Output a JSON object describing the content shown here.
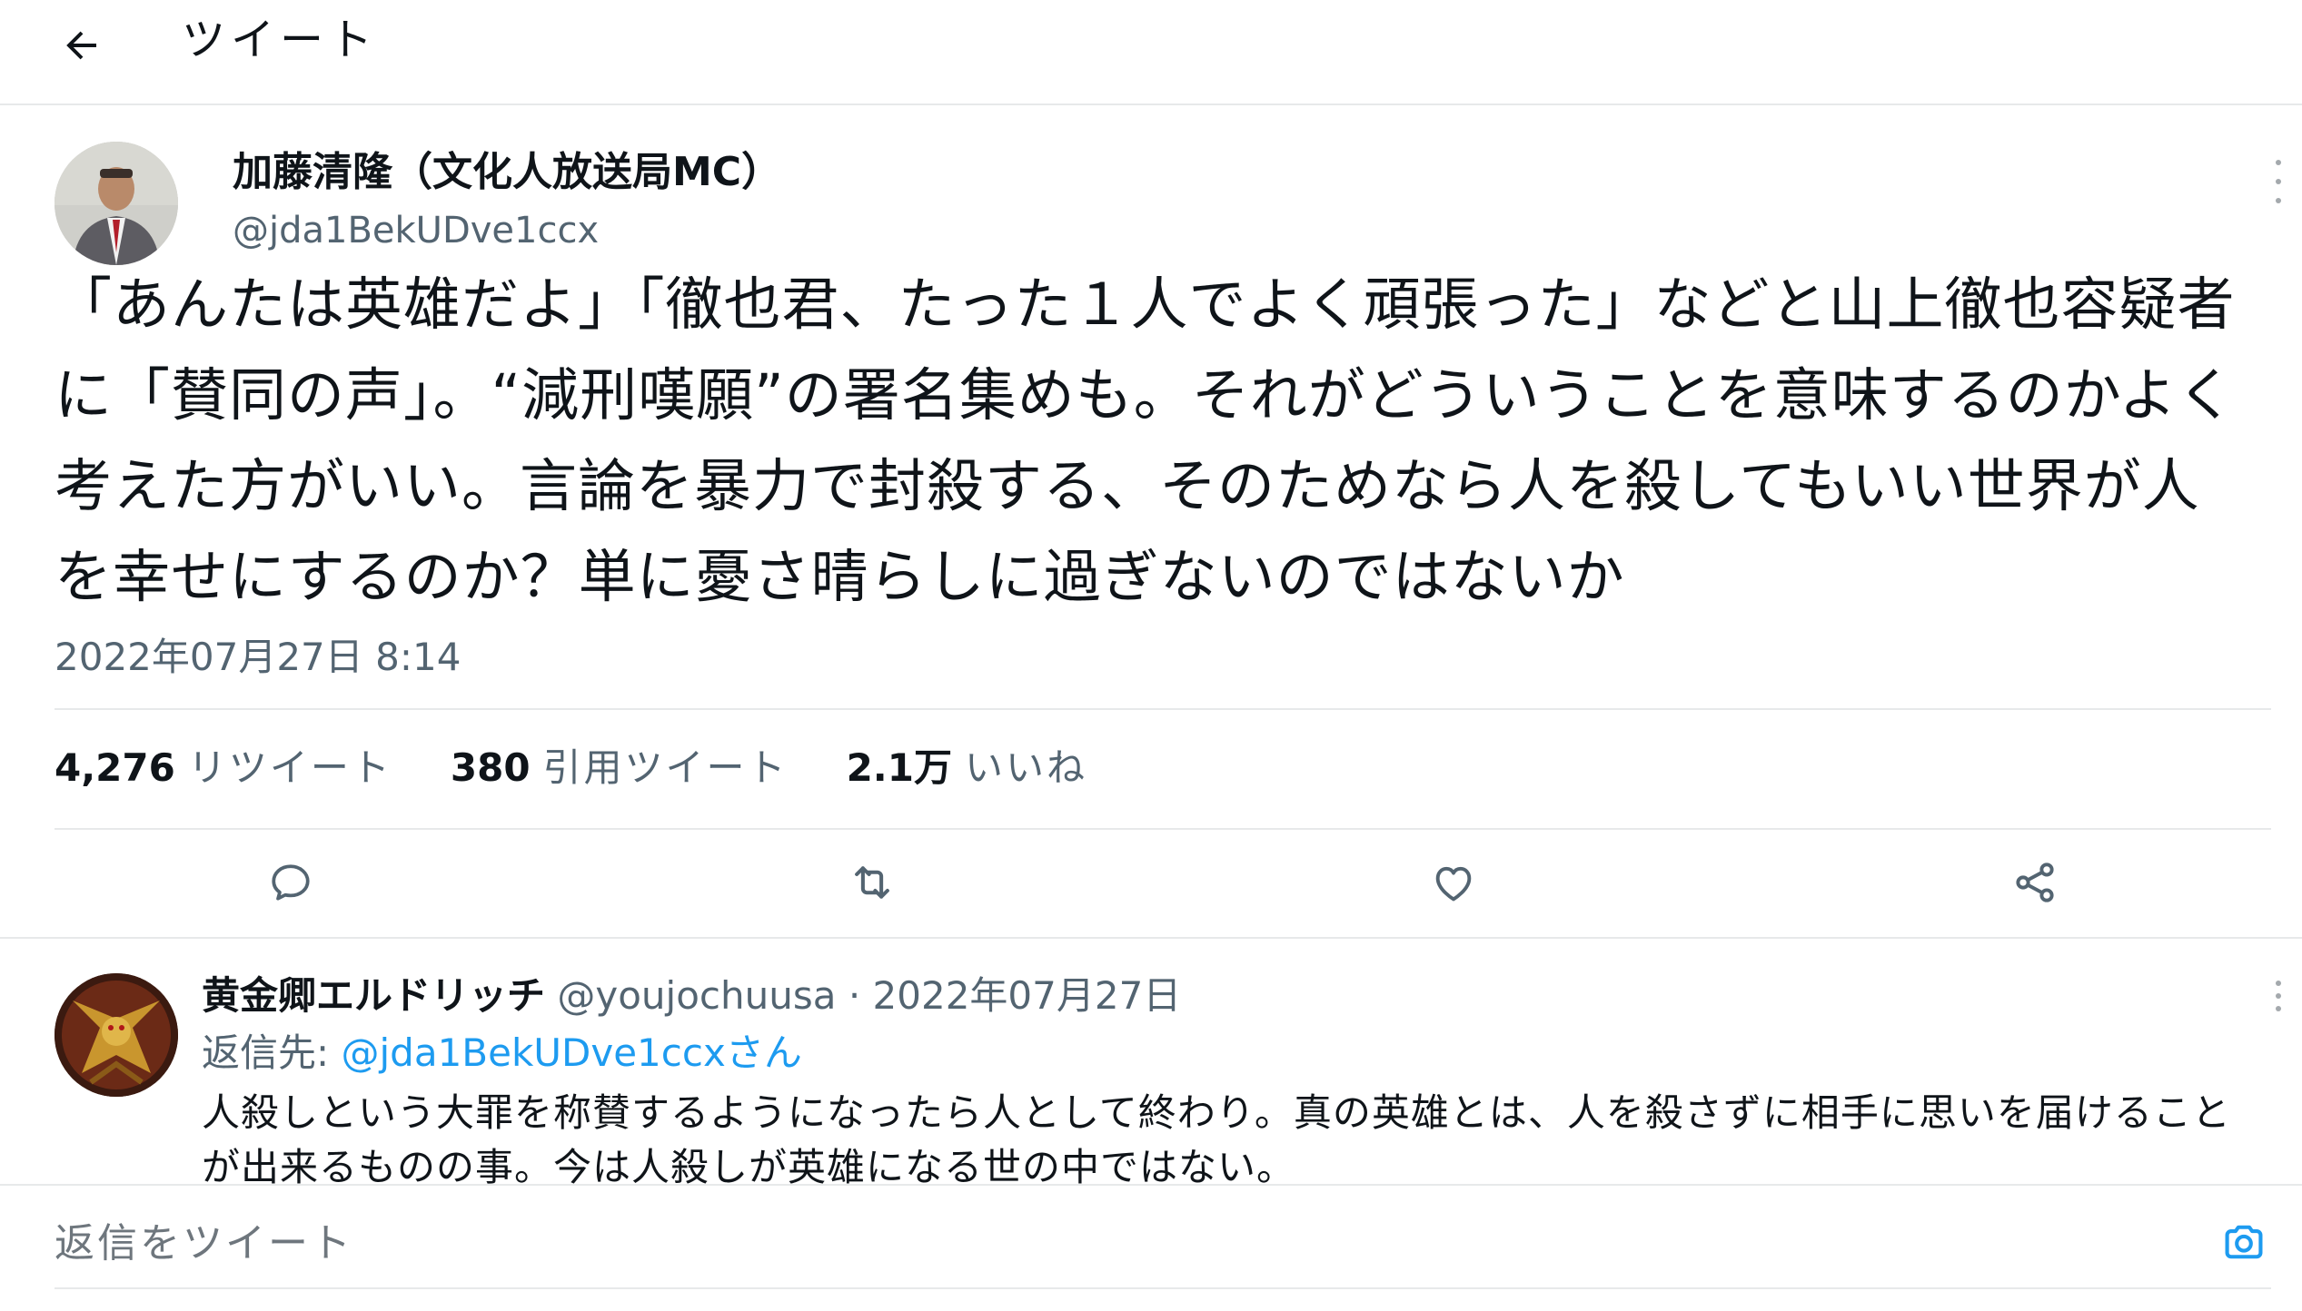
{
  "header": {
    "title": "ツイート",
    "back_icon": "arrow-left-icon"
  },
  "tweet": {
    "display_name": "加藤清隆（文化人放送局MC）",
    "handle": "@jda1BekUDve1ccx",
    "text": "「あんたは英雄だよ」「徹也君、たった１人でよく頑張った」などと山上徹也容疑者に「賛同の声」。“減刑嘆願”の署名集めも。それがどういうことを意味するのかよく考えた方がいい。言論を暴力で封殺する、そのためなら人を殺してもいい世界が人を幸せにするのか？単に憂さ晴らしに過ぎないのではないか",
    "timestamp": "2022年07月27日 8:14",
    "stats": [
      {
        "count": "4,276",
        "label": "リツイート"
      },
      {
        "count": "380",
        "label": "引用ツイート"
      },
      {
        "count": "2.1万",
        "label": "いいね"
      }
    ],
    "actions": [
      "reply-icon",
      "retweet-icon",
      "like-icon",
      "share-icon"
    ]
  },
  "reply": {
    "display_name": "黄金卿エルドリッチ",
    "meta": "@youjochuusa · 2022年07月27日",
    "reply_to_prefix": "返信先: ",
    "reply_to_mention": "@jda1BekUDve1ccxさん",
    "text": "人殺しという大罪を称賛するようになったら人として終わり。真の英雄とは、人を殺さずに相手に思いを届けることが出来るものの事。今は人殺しが英雄になる世の中ではない。"
  },
  "composer": {
    "placeholder": "返信をツイート",
    "camera_icon": "camera-icon"
  },
  "colors": {
    "accent": "#1d9bf0",
    "secondary_text": "#536471",
    "divider": "#e7e9ea"
  }
}
